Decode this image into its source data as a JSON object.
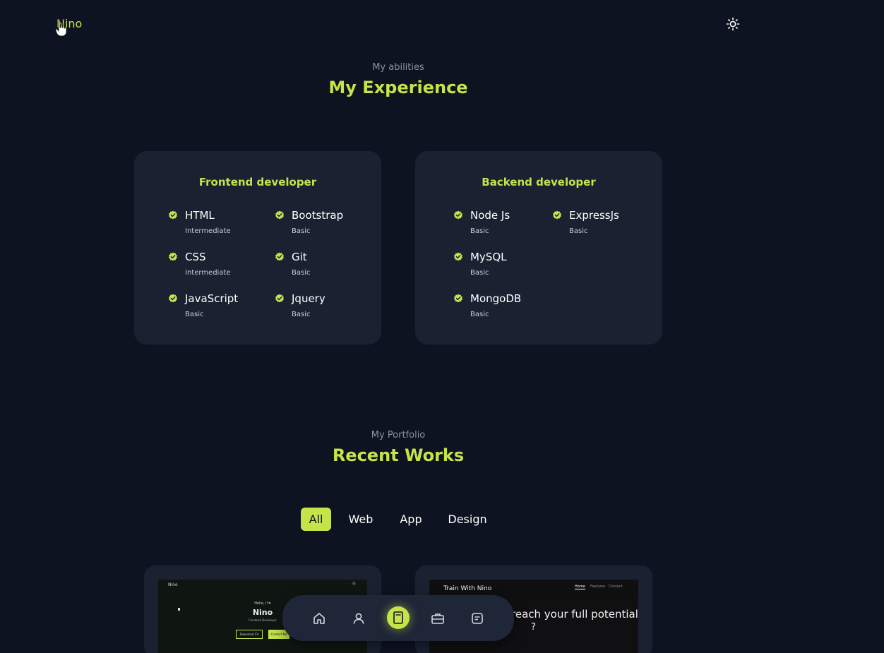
{
  "header": {
    "logo": "Nino",
    "theme_icon": "sun-icon"
  },
  "colors": {
    "background": "#0d1320",
    "card": "#1a2232",
    "accent": "#c6e34a",
    "muted_text": "#8b93a3"
  },
  "experience": {
    "subtitle": "My abilities",
    "title": "My Experience",
    "frontend": {
      "title": "Frontend developer",
      "skills": [
        {
          "name": "HTML",
          "level": "Intermediate"
        },
        {
          "name": "Bootstrap",
          "level": "Basic"
        },
        {
          "name": "CSS",
          "level": "Intermediate"
        },
        {
          "name": "Git",
          "level": "Basic"
        },
        {
          "name": "JavaScript",
          "level": "Basic"
        },
        {
          "name": "Jquery",
          "level": "Basic"
        }
      ]
    },
    "backend": {
      "title": "Backend developer",
      "skills": [
        {
          "name": "Node Js",
          "level": "Basic"
        },
        {
          "name": "ExpressJs",
          "level": "Basic"
        },
        {
          "name": "MySQL",
          "level": "Basic"
        },
        {
          "name": "MongoDB",
          "level": "Basic"
        }
      ]
    }
  },
  "portfolio": {
    "subtitle": "My Portfolio",
    "title": "Recent Works",
    "filters": [
      {
        "label": "All",
        "active": true
      },
      {
        "label": "Web",
        "active": false
      },
      {
        "label": "App",
        "active": false
      },
      {
        "label": "Design",
        "active": false
      }
    ],
    "works": [
      {
        "header_left": "Nino",
        "greeting": "Hello, I'm",
        "name": "Nino",
        "role": "Frontend Developer",
        "btn1": "Download CV",
        "btn2": "Contact Me"
      },
      {
        "brand": "Train With Nino",
        "nav": [
          "Home",
          "Features",
          "Contact"
        ],
        "headline": "reach your full potential",
        "headline2": "?"
      }
    ]
  },
  "dock": {
    "items": [
      {
        "icon": "home-icon",
        "active": false
      },
      {
        "icon": "user-icon",
        "active": false
      },
      {
        "icon": "book-icon",
        "active": true
      },
      {
        "icon": "briefcase-icon",
        "active": false
      },
      {
        "icon": "message-icon",
        "active": false
      }
    ]
  }
}
